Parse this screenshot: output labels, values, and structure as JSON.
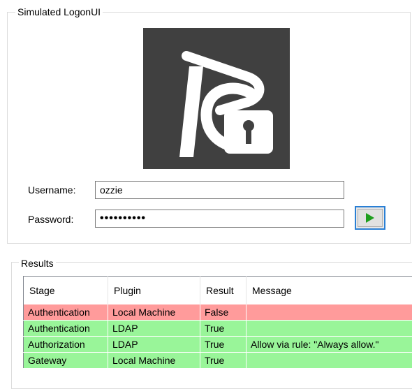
{
  "logon_group": {
    "title": "Simulated LogonUI",
    "username_label": "Username:",
    "username_value": "ozzie",
    "password_label": "Password:",
    "password_value": "••••••••••",
    "submit_icon": "play-icon"
  },
  "results_group": {
    "title": "Results",
    "columns": [
      "Stage",
      "Plugin",
      "Result",
      "Message"
    ],
    "rows": [
      {
        "stage": "Authentication",
        "plugin": "Local Machine",
        "result": "False",
        "message": "",
        "status": "fail"
      },
      {
        "stage": "Authentication",
        "plugin": "LDAP",
        "result": "True",
        "message": "",
        "status": "pass"
      },
      {
        "stage": "Authorization",
        "plugin": "LDAP",
        "result": "True",
        "message": "Allow via rule: \"Always allow.\"",
        "status": "pass"
      },
      {
        "stage": "Gateway",
        "plugin": "Local Machine",
        "result": "True",
        "message": "",
        "status": "pass"
      }
    ]
  },
  "colors": {
    "fail_row": "#ff9b9b",
    "pass_row": "#99f599",
    "logo_bg": "#404040",
    "play_icon": "#1e9e1e",
    "focus_border": "#2a7fd4"
  }
}
